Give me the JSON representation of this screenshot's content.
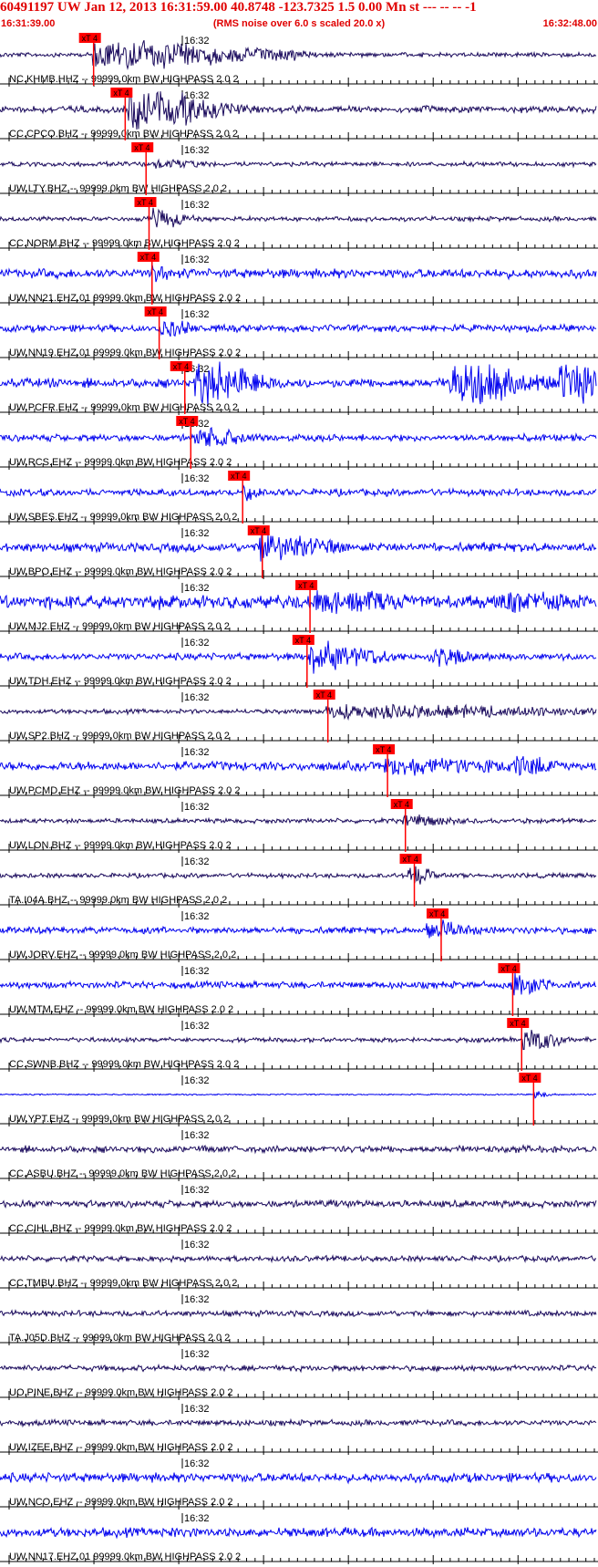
{
  "header": {
    "title": "60491197 UW Jan 12, 2013 16:31:59.00   40.8748 -123.7325  1.5 0.00 Mn st --- -- --  -1",
    "subtitle": "(RMS noise over 6.0 s scaled 20.0 x)",
    "start_time": "16:31:39.00",
    "end_time": "16:32:48.00"
  },
  "time_tick_label": "16:32",
  "pick_label": "xT 4",
  "colors": {
    "header_text": "#e00000",
    "pick": "#ff0000",
    "trace_dark": "#1a0a5c",
    "trace_blue": "#0000ee",
    "axis": "#000000"
  },
  "traces": [
    {
      "label": "NC.KHMB.HHZ -- 99999.0km BW  HIGHPASS  2.0  2",
      "color": "dark",
      "amp": 22,
      "noise": 2,
      "pick": 0.157,
      "bursts": [
        [
          0.16,
          0.22,
          20
        ],
        [
          0.45,
          0.06,
          10
        ]
      ]
    },
    {
      "label": "CC.CPCO.BHZ -- 99999.0km BW  HIGHPASS  2.0  2",
      "color": "dark",
      "amp": 26,
      "noise": 3,
      "pick": 0.21,
      "bursts": [
        [
          0.22,
          0.12,
          26
        ]
      ]
    },
    {
      "label": "UW.LTY.BHZ -- 99999.0km BW  HIGHPASS  2.0  2",
      "color": "dark",
      "amp": 10,
      "noise": 2,
      "pick": 0.245,
      "bursts": [
        [
          0.26,
          0.06,
          8
        ]
      ]
    },
    {
      "label": "CC.NORM.BHZ -- 99999.0km BW  HIGHPASS  2.0  2",
      "color": "dark",
      "amp": 14,
      "noise": 2,
      "pick": 0.25,
      "bursts": [
        [
          0.26,
          0.05,
          14
        ]
      ]
    },
    {
      "label": "UW.NN21.EHZ.01 99999.0km BW  HIGHPASS  2.0  2",
      "color": "blue",
      "amp": 12,
      "noise": 4,
      "pick": 0.255,
      "bursts": [
        [
          0.26,
          0.03,
          12
        ]
      ]
    },
    {
      "label": "UW.NN19.EHZ.01 99999.0km BW  HIGHPASS  2.0  2",
      "color": "blue",
      "amp": 12,
      "noise": 3,
      "pick": 0.267,
      "bursts": [
        [
          0.27,
          0.05,
          12
        ]
      ]
    },
    {
      "label": "UW.PCFR.EHZ -- 99999.0km BW  HIGHPASS  2.0  2",
      "color": "blue",
      "amp": 28,
      "noise": 4,
      "pick": 0.31,
      "bursts": [
        [
          0.33,
          0.09,
          28
        ],
        [
          0.76,
          0.12,
          28
        ],
        [
          0.94,
          0.08,
          28
        ]
      ]
    },
    {
      "label": "UW.RCS.EHZ -- 99999.0km BW  HIGHPASS  2.0  2",
      "color": "blue",
      "amp": 14,
      "noise": 3,
      "pick": 0.32,
      "bursts": [
        [
          0.33,
          0.08,
          14
        ]
      ]
    },
    {
      "label": "UW.SBES.EHZ -- 99999.0km BW  HIGHPASS  2.0  2",
      "color": "blue",
      "amp": 14,
      "noise": 3,
      "pick": 0.407,
      "bursts": [
        [
          0.41,
          0.02,
          14
        ]
      ]
    },
    {
      "label": "UW.BPO.EHZ -- 99999.0km BW  HIGHPASS  2.0  2",
      "color": "blue",
      "amp": 20,
      "noise": 4,
      "pick": 0.44,
      "bursts": [
        [
          0.44,
          0.1,
          20
        ]
      ]
    },
    {
      "label": "UW.MJ2.EHZ -- 99999.0km BW  HIGHPASS  2.0  2",
      "color": "blue",
      "amp": 16,
      "noise": 6,
      "pick": 0.52,
      "bursts": [
        [
          0.53,
          0.15,
          16
        ],
        [
          0.85,
          0.12,
          14
        ]
      ]
    },
    {
      "label": "UW.TDH.EHZ -- 99999.0km BW  HIGHPASS  2.0  2",
      "color": "blue",
      "amp": 20,
      "noise": 3,
      "pick": 0.515,
      "bursts": [
        [
          0.52,
          0.1,
          20
        ],
        [
          0.72,
          0.08,
          12
        ]
      ]
    },
    {
      "label": "UW.SP2.BHZ -- 99999.0km BW  HIGHPASS  2.0  2",
      "color": "dark",
      "amp": 10,
      "noise": 2,
      "pick": 0.55,
      "bursts": [
        [
          0.55,
          0.45,
          9
        ]
      ]
    },
    {
      "label": "UW.PCMD.EHZ -- 99999.0km BW  HIGHPASS  2.0  2",
      "color": "blue",
      "amp": 14,
      "noise": 4,
      "pick": 0.65,
      "bursts": [
        [
          0.65,
          0.2,
          12
        ],
        [
          0.87,
          0.06,
          14
        ]
      ]
    },
    {
      "label": "UW.LON.BHZ -- 99999.0km BW  HIGHPASS  2.0  2",
      "color": "dark",
      "amp": 8,
      "noise": 2,
      "pick": 0.68,
      "bursts": [
        [
          0.68,
          0.08,
          8
        ]
      ]
    },
    {
      "label": "TA.I04A.BHZ -- 99999.0km BW  HIGHPASS  2.0  2",
      "color": "dark",
      "amp": 14,
      "noise": 2,
      "pick": 0.695,
      "bursts": [
        [
          0.69,
          0.03,
          14
        ]
      ]
    },
    {
      "label": "UW.JORV.EHZ -- 99999.0km BW  HIGHPASS  2.0  2",
      "color": "blue",
      "amp": 14,
      "noise": 3,
      "pick": 0.74,
      "bursts": [
        [
          0.72,
          0.06,
          14
        ]
      ]
    },
    {
      "label": "UW.MTM.EHZ -- 99999.0km BW  HIGHPASS  2.0  2",
      "color": "blue",
      "amp": 16,
      "noise": 3,
      "pick": 0.86,
      "bursts": [
        [
          0.86,
          0.05,
          16
        ]
      ]
    },
    {
      "label": "CC.SWNB.BHZ -- 99999.0km BW  HIGHPASS  2.0  2",
      "color": "dark",
      "amp": 16,
      "noise": 2,
      "pick": 0.875,
      "bursts": [
        [
          0.88,
          0.05,
          16
        ]
      ]
    },
    {
      "label": "UW.YPT.EHZ -- 99999.0km BW  HIGHPASS  2.0  2",
      "color": "blue",
      "amp": 5,
      "noise": 0.6,
      "pick": 0.895,
      "bursts": [
        [
          0.9,
          0.02,
          5
        ]
      ]
    },
    {
      "label": "CC.ASBU.BHZ -- 99999.0km BW  HIGHPASS  2.0  2",
      "color": "dark",
      "amp": 3,
      "noise": 3,
      "pick": null,
      "bursts": []
    },
    {
      "label": "CC.CIHL.BHZ -- 99999.0km BW  HIGHPASS  2.0  2",
      "color": "dark",
      "amp": 6,
      "noise": 3,
      "pick": null,
      "bursts": [
        [
          0.53,
          0.05,
          6
        ]
      ]
    },
    {
      "label": "CC.TMBU.BHZ -- 99999.0km BW  HIGHPASS  2.0  2",
      "color": "dark",
      "amp": 3,
      "noise": 2.5,
      "pick": null,
      "bursts": []
    },
    {
      "label": "TA.J05D.BHZ -- 99999.0km BW  HIGHPASS  2.0  2",
      "color": "dark",
      "amp": 3,
      "noise": 2.5,
      "pick": null,
      "bursts": []
    },
    {
      "label": "UO.PINE.BHZ -- 99999.0km BW  HIGHPASS  2.0  2",
      "color": "dark",
      "amp": 3,
      "noise": 2.5,
      "pick": null,
      "bursts": []
    },
    {
      "label": "UW.IZEE.BHZ -- 99999.0km BW  HIGHPASS  2.0  2",
      "color": "dark",
      "amp": 3,
      "noise": 2.5,
      "pick": null,
      "bursts": []
    },
    {
      "label": "UW.NCO.EHZ -- 99999.0km BW  HIGHPASS  2.0  2",
      "color": "blue",
      "amp": 4,
      "noise": 4,
      "pick": null,
      "bursts": []
    },
    {
      "label": "UW.NN17.EHZ.01 99999.0km BW  HIGHPASS  2.0  2",
      "color": "blue",
      "amp": 6,
      "noise": 4,
      "pick": null,
      "bursts": [
        [
          0.27,
          0.08,
          6
        ]
      ]
    }
  ]
}
